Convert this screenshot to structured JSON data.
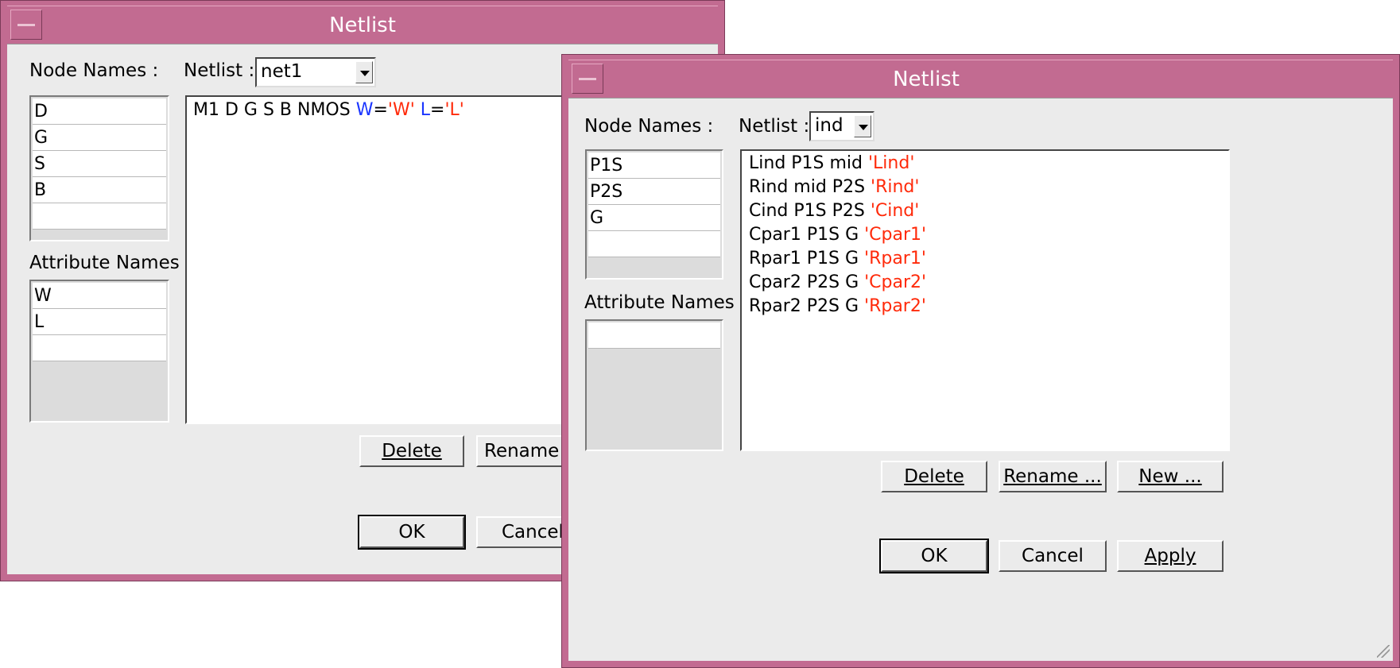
{
  "back_window": {
    "title": "Netlist",
    "node_names_label": "Node Names :",
    "netlist_label": "Netlist :",
    "netlist_value": "net1",
    "nodes": [
      "D",
      "G",
      "S",
      "B"
    ],
    "attribute_names_label": "Attribute Names :",
    "attributes": [
      "W",
      "L"
    ],
    "lines": [
      {
        "plain": "M1 D G S B NMOS ",
        "blue1": "W",
        "eq1": "=",
        "red1": "'W'",
        "blue2": " L",
        "eq2": "=",
        "red2": "'L'"
      }
    ],
    "delete_label": "Delete",
    "rename_label": "Rename",
    "ok_label": "OK",
    "cancel_label": "Cancel"
  },
  "front_window": {
    "title": "Netlist",
    "node_names_label": "Node Names :",
    "netlist_label": "Netlist :",
    "netlist_value": "ind",
    "nodes": [
      "P1S",
      "P2S",
      "G"
    ],
    "attribute_names_label": "Attribute Names :",
    "attributes": [],
    "lines": [
      {
        "plain": "Lind P1S mid ",
        "value": "'Lind'"
      },
      {
        "plain": "Rind mid P2S ",
        "value": "'Rind'"
      },
      {
        "plain": "Cind P1S P2S ",
        "value": "'Cind'"
      },
      {
        "plain": "Cpar1 P1S G ",
        "value": "'Cpar1'"
      },
      {
        "plain": "Rpar1 P1S G ",
        "value": "'Rpar1'"
      },
      {
        "plain": "Cpar2 P2S G ",
        "value": "'Cpar2'"
      },
      {
        "plain": "Rpar2 P2S G ",
        "value": "'Rpar2'"
      }
    ],
    "delete_label": "Delete",
    "rename_label": "Rename ...",
    "new_label": "New ...",
    "ok_label": "OK",
    "cancel_label": "Cancel",
    "apply_label": "Apply"
  },
  "colors": {
    "titlebar": "#c26b91",
    "value_text": "#ff2a0a",
    "attr_text": "#1a35ff"
  }
}
